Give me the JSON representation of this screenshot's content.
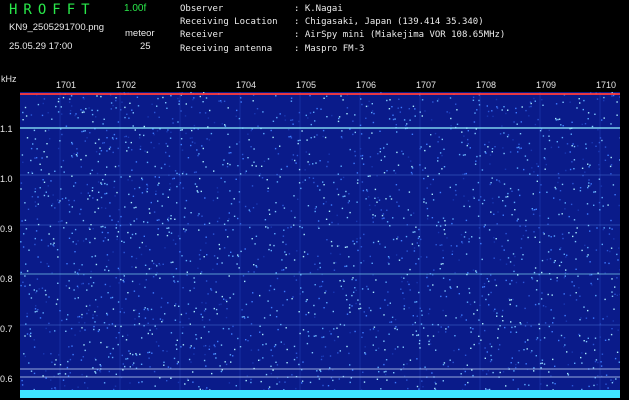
{
  "header": {
    "brand": "HROFFT",
    "version": "1.00f",
    "filename": "KN9_2505291700.png",
    "meteor_label": "meteor",
    "datetime": "25.05.29 17:00",
    "meteor_count": "25"
  },
  "station_info": [
    {
      "key": "Observer",
      "value": ": K.Nagai"
    },
    {
      "key": "Receiving Location",
      "value": ": Chigasaki, Japan (139.414 35.340)"
    },
    {
      "key": "Receiver",
      "value": ": AirSpy mini (Miakejima VOR 108.65MHz)"
    },
    {
      "key": "Receiving antenna",
      "value": ": Maspro FM-3"
    }
  ],
  "axis": {
    "y_unit": "kHz",
    "y_ticks": [
      "1.1",
      "1.0",
      "0.9",
      "0.8",
      "0.7",
      "0.6"
    ],
    "x_ticks": [
      "1701",
      "1702",
      "1703",
      "1704",
      "1705",
      "1706",
      "1707",
      "1708",
      "1709",
      "1710"
    ]
  },
  "colors": {
    "background": "#000000",
    "spectrum_base": "#0a1b8a",
    "noise": "#5aa9ff",
    "signal_line": "#8ff0ff",
    "top_line": "#ff3b3b",
    "bottom_band": "#3fe6ff",
    "brand": "#29e84a"
  }
}
